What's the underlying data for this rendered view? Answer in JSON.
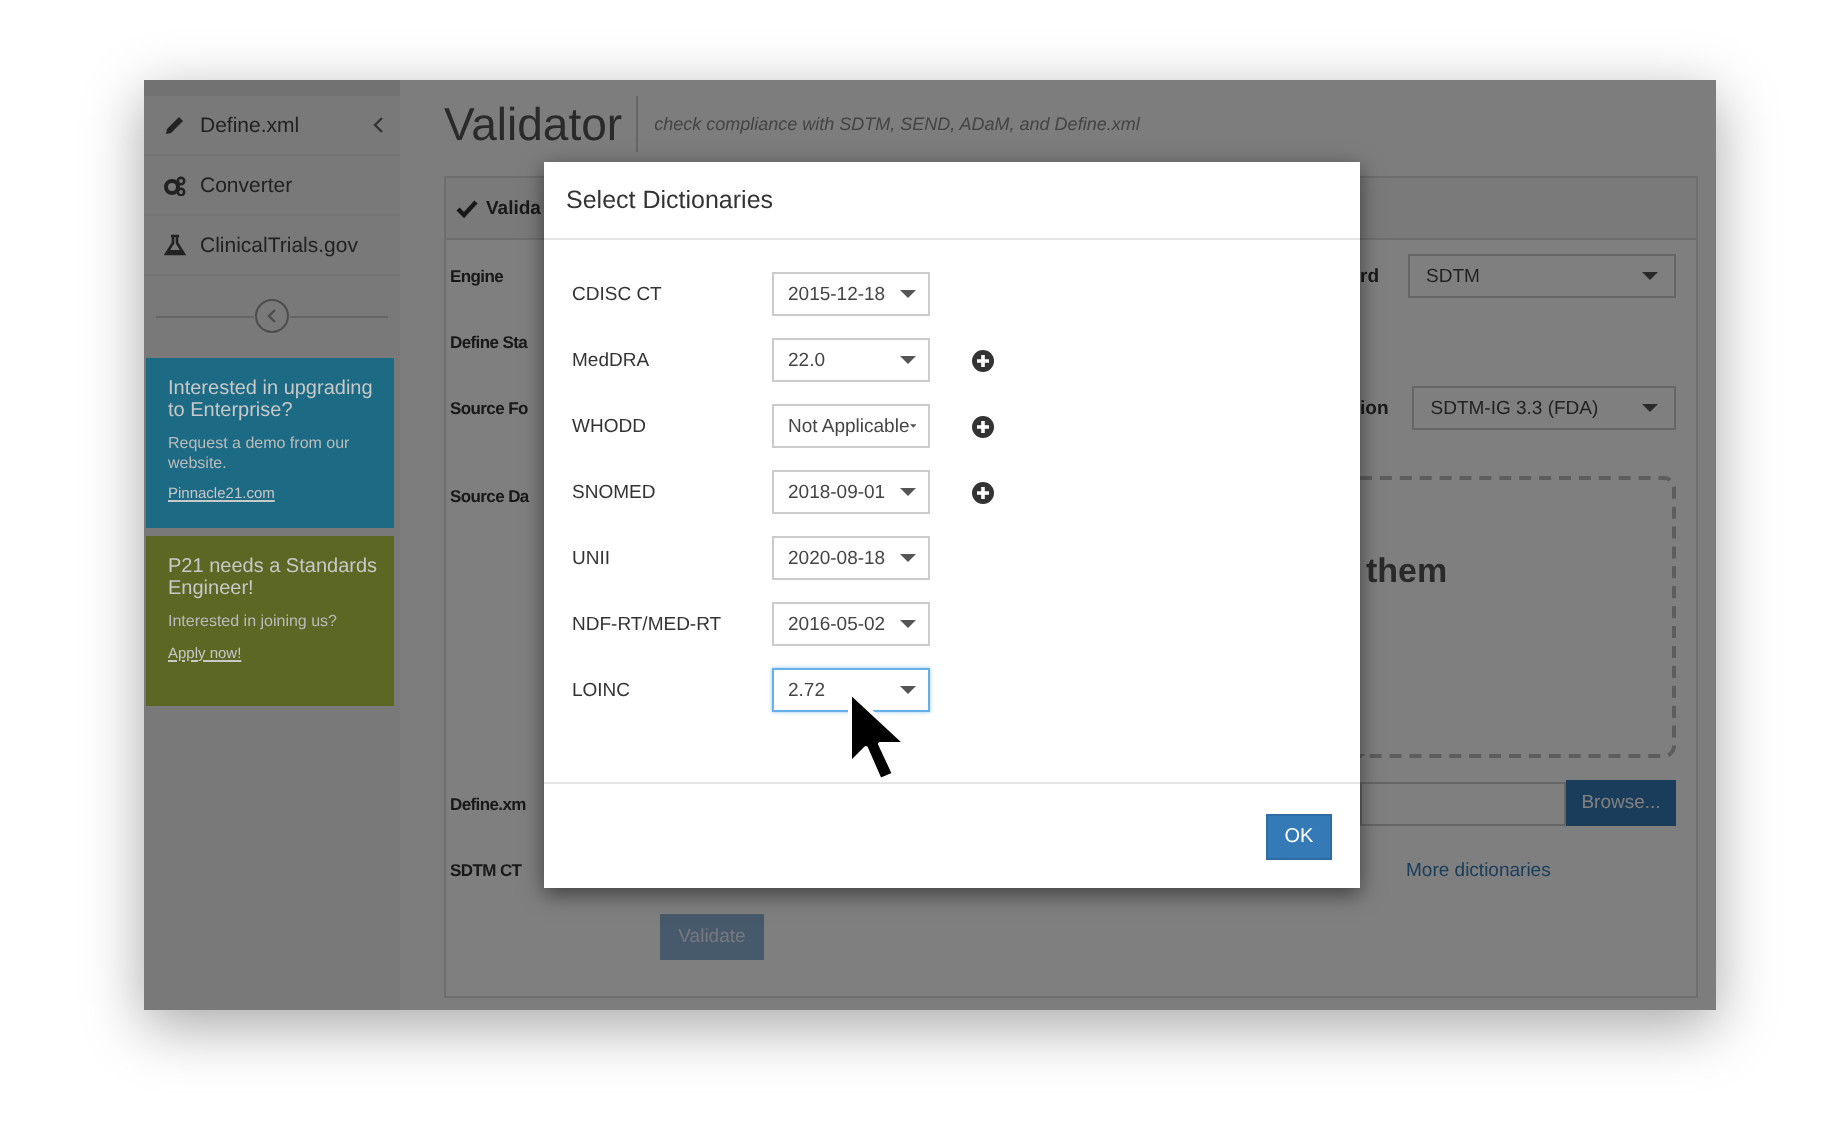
{
  "sidebar": {
    "items": [
      {
        "label": "Define.xml",
        "collapsible": true
      },
      {
        "label": "Converter",
        "collapsible": false
      },
      {
        "label": "ClinicalTrials.gov",
        "collapsible": false
      }
    ]
  },
  "promos": [
    {
      "color": "#1c6a84",
      "heading": "Interested in upgrading to Enterprise?",
      "text": "Request a demo from our website.",
      "link": "Pinnacle21.com"
    },
    {
      "color": "#5d6724",
      "heading": "P21 needs a Standards Engineer!",
      "text": "Interested in joining us?",
      "link": "Apply now!"
    }
  ],
  "page": {
    "title": "Validator",
    "subtitle": "check compliance with SDTM, SEND, ADaM, and Define.xml"
  },
  "panel": {
    "tab": "Valida",
    "rows": [
      {
        "kind": "select",
        "label": "Engine",
        "right_label": "rd",
        "value": "SDTM"
      },
      {
        "kind": "plain",
        "label": "Define Sta"
      },
      {
        "kind": "select",
        "label": "Source Fo",
        "right_label": "ion",
        "value": "SDTM-IG 3.3 (FDA)"
      },
      {
        "kind": "dropzone",
        "label": "Source Da",
        "text": "them"
      },
      {
        "kind": "file",
        "label": "Define.xm",
        "button": "Browse..."
      },
      {
        "kind": "link",
        "label": "SDTM CT",
        "link": "More dictionaries"
      }
    ],
    "validate_button": {
      "label": "Validate",
      "disabled": true
    }
  },
  "dialog": {
    "title": "Select Dictionaries",
    "rows": [
      {
        "label": "CDISC CT",
        "value": "2015-12-18",
        "focused": false,
        "addable": false
      },
      {
        "label": "MedDRA",
        "value": "22.0",
        "focused": false,
        "addable": true
      },
      {
        "label": "WHODD",
        "value": "Not Applicable",
        "focused": false,
        "addable": true
      },
      {
        "label": "SNOMED",
        "value": "2018-09-01",
        "focused": false,
        "addable": true
      },
      {
        "label": "UNII",
        "value": "2020-08-18",
        "focused": false,
        "addable": false
      },
      {
        "label": "NDF-RT/MED-RT",
        "value": "2016-05-02",
        "focused": false,
        "addable": false
      },
      {
        "label": "LOINC",
        "value": "2.72",
        "focused": true,
        "addable": false
      }
    ],
    "ok_button": "OK"
  }
}
